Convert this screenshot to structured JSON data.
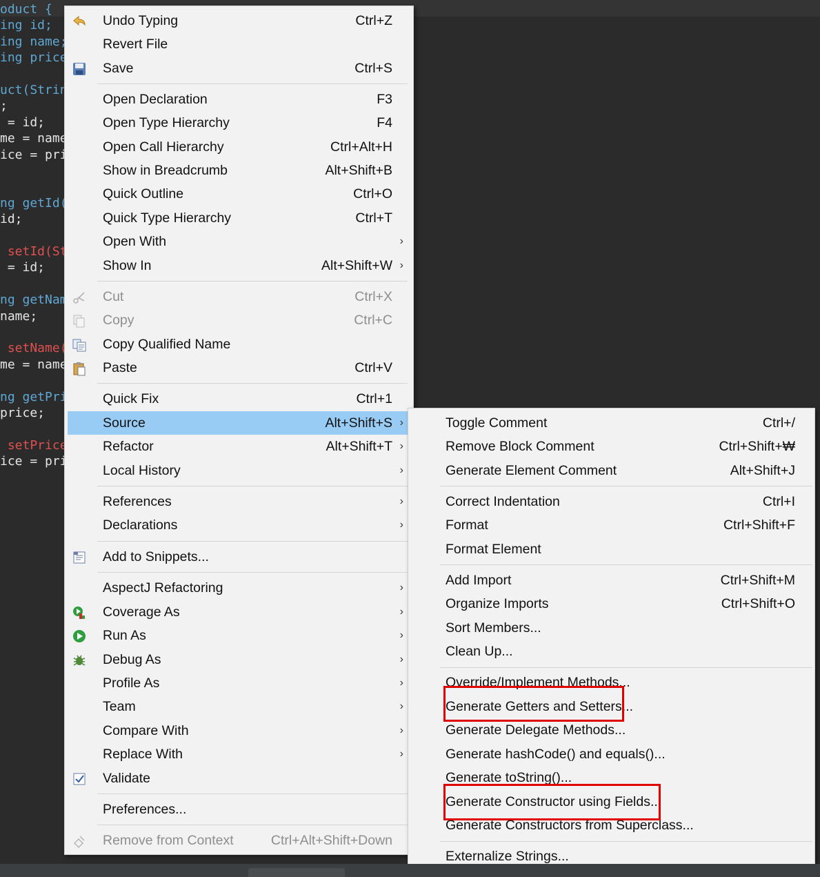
{
  "editor": {
    "lines": [
      {
        "t": "oduct {",
        "c": "kw"
      },
      {
        "t": "ing id;",
        "c": "kw"
      },
      {
        "t": "ing name;",
        "c": "kw"
      },
      {
        "t": "ing price",
        "c": "kw"
      },
      {
        "t": "",
        "c": ""
      },
      {
        "t": "uct(Strin",
        "c": "kw"
      },
      {
        "t": ";",
        "c": ""
      },
      {
        "t": " = id;",
        "c": ""
      },
      {
        "t": "me = name",
        "c": ""
      },
      {
        "t": "ice = pri",
        "c": ""
      },
      {
        "t": "",
        "c": ""
      },
      {
        "t": "",
        "c": ""
      },
      {
        "t": "ng getId(",
        "c": "kw"
      },
      {
        "t": "id;",
        "c": ""
      },
      {
        "t": "",
        "c": ""
      },
      {
        "t": " setId(St",
        "c": "mk"
      },
      {
        "t": " = id;",
        "c": ""
      },
      {
        "t": "",
        "c": ""
      },
      {
        "t": "ng getNam",
        "c": "kw"
      },
      {
        "t": "name;",
        "c": ""
      },
      {
        "t": "",
        "c": ""
      },
      {
        "t": " setName(",
        "c": "mk"
      },
      {
        "t": "me = name",
        "c": ""
      },
      {
        "t": "",
        "c": ""
      },
      {
        "t": "ng getPri",
        "c": "kw"
      },
      {
        "t": "price;",
        "c": ""
      },
      {
        "t": "",
        "c": ""
      },
      {
        "t": " setPrice",
        "c": "mk"
      },
      {
        "t": "ice = pri",
        "c": ""
      }
    ]
  },
  "context_menu": {
    "items": [
      {
        "label": "Undo Typing",
        "shortcut": "Ctrl+Z",
        "icon": "undo-icon"
      },
      {
        "label": "Revert File",
        "shortcut": ""
      },
      {
        "label": "Save",
        "shortcut": "Ctrl+S",
        "icon": "save-icon"
      },
      {
        "label": "Open Declaration",
        "shortcut": "F3"
      },
      {
        "label": "Open Type Hierarchy",
        "shortcut": "F4"
      },
      {
        "label": "Open Call Hierarchy",
        "shortcut": "Ctrl+Alt+H"
      },
      {
        "label": "Show in Breadcrumb",
        "shortcut": "Alt+Shift+B"
      },
      {
        "label": "Quick Outline",
        "shortcut": "Ctrl+O"
      },
      {
        "label": "Quick Type Hierarchy",
        "shortcut": "Ctrl+T"
      },
      {
        "label": "Open With",
        "shortcut": ""
      },
      {
        "label": "Show In",
        "shortcut": "Alt+Shift+W"
      },
      {
        "label": "Cut",
        "shortcut": "Ctrl+X",
        "icon": "cut-icon",
        "disabled": true
      },
      {
        "label": "Copy",
        "shortcut": "Ctrl+C",
        "icon": "copy-icon",
        "disabled": true
      },
      {
        "label": "Copy Qualified Name",
        "shortcut": "",
        "icon": "copy-qualified-name-icon"
      },
      {
        "label": "Paste",
        "shortcut": "Ctrl+V",
        "icon": "paste-icon"
      },
      {
        "label": "Quick Fix",
        "shortcut": "Ctrl+1"
      },
      {
        "label": "Source",
        "shortcut": "Alt+Shift+S",
        "highlighted": true
      },
      {
        "label": "Refactor",
        "shortcut": "Alt+Shift+T"
      },
      {
        "label": "Local History",
        "shortcut": ""
      },
      {
        "label": "References",
        "shortcut": ""
      },
      {
        "label": "Declarations",
        "shortcut": ""
      },
      {
        "label": "Add to Snippets...",
        "shortcut": "",
        "icon": "snippets-icon"
      },
      {
        "label": "AspectJ Refactoring",
        "shortcut": ""
      },
      {
        "label": "Coverage As",
        "shortcut": "",
        "icon": "coverage-icon"
      },
      {
        "label": "Run As",
        "shortcut": "",
        "icon": "run-icon"
      },
      {
        "label": "Debug As",
        "shortcut": "",
        "icon": "debug-bug-icon"
      },
      {
        "label": "Profile As",
        "shortcut": ""
      },
      {
        "label": "Team",
        "shortcut": ""
      },
      {
        "label": "Compare With",
        "shortcut": ""
      },
      {
        "label": "Replace With",
        "shortcut": ""
      },
      {
        "label": "Validate",
        "shortcut": "",
        "icon": "validate-checkbox-icon"
      },
      {
        "label": "Preferences...",
        "shortcut": ""
      },
      {
        "label": "Remove from Context",
        "shortcut": "Ctrl+Alt+Shift+Down",
        "icon": "remove-context-icon",
        "disabled": true
      }
    ]
  },
  "source_submenu": {
    "items": [
      {
        "label": "Toggle Comment",
        "shortcut": "Ctrl+/"
      },
      {
        "label": "Remove Block Comment",
        "shortcut": "Ctrl+Shift+₩"
      },
      {
        "label": "Generate Element Comment",
        "shortcut": "Alt+Shift+J"
      },
      {
        "label": "Correct Indentation",
        "shortcut": "Ctrl+I"
      },
      {
        "label": "Format",
        "shortcut": "Ctrl+Shift+F"
      },
      {
        "label": "Format Element",
        "shortcut": ""
      },
      {
        "label": "Add Import",
        "shortcut": "Ctrl+Shift+M"
      },
      {
        "label": "Organize Imports",
        "shortcut": "Ctrl+Shift+O"
      },
      {
        "label": "Sort Members...",
        "shortcut": ""
      },
      {
        "label": "Clean Up...",
        "shortcut": ""
      },
      {
        "label": "Override/Implement Methods...",
        "shortcut": ""
      },
      {
        "label": "Generate Getters and Setters...",
        "shortcut": ""
      },
      {
        "label": "Generate Delegate Methods...",
        "shortcut": ""
      },
      {
        "label": "Generate hashCode() and equals()...",
        "shortcut": ""
      },
      {
        "label": "Generate toString()...",
        "shortcut": ""
      },
      {
        "label": "Generate Constructor using Fields...",
        "shortcut": ""
      },
      {
        "label": "Generate Constructors from Superclass...",
        "shortcut": ""
      },
      {
        "label": "Externalize Strings...",
        "shortcut": ""
      }
    ]
  },
  "colors": {
    "highlight": "#99ccf5",
    "annotation_box": "#e00000",
    "menu_background": "#f2f2f2",
    "editor_background": "#2b2b2b"
  }
}
